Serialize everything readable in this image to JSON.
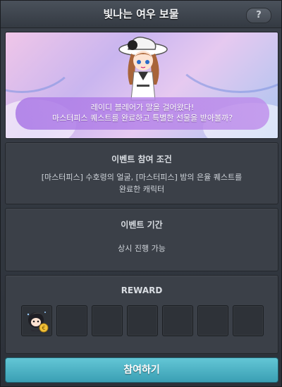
{
  "window": {
    "title": "빛나는 여우 보물",
    "help_label": "?"
  },
  "banner": {
    "line1": "레이디 블레어가 말을 걸어왔다!",
    "line2": "마스터피스 퀘스트를 완료하고 특별한 선물을 받아볼까?"
  },
  "condition": {
    "title": "이벤트 참여 조건",
    "line1": "[마스터피스] 수호령의 얼굴, [마스터피스] 밤의 은율 퀘스트를",
    "line2": "완료한 캐릭터"
  },
  "period": {
    "title": "이벤트 기간",
    "text": "상시 진행 가능"
  },
  "reward": {
    "title": "REWARD",
    "slots": [
      {
        "item": "character-pet-icon"
      },
      {
        "item": ""
      },
      {
        "item": ""
      },
      {
        "item": ""
      },
      {
        "item": ""
      },
      {
        "item": ""
      },
      {
        "item": ""
      }
    ]
  },
  "join_button": {
    "label": "참여하기"
  },
  "colors": {
    "accent": "#4fb3c7",
    "panel": "#3b4048",
    "banner_bubble": "#b27ee6"
  }
}
